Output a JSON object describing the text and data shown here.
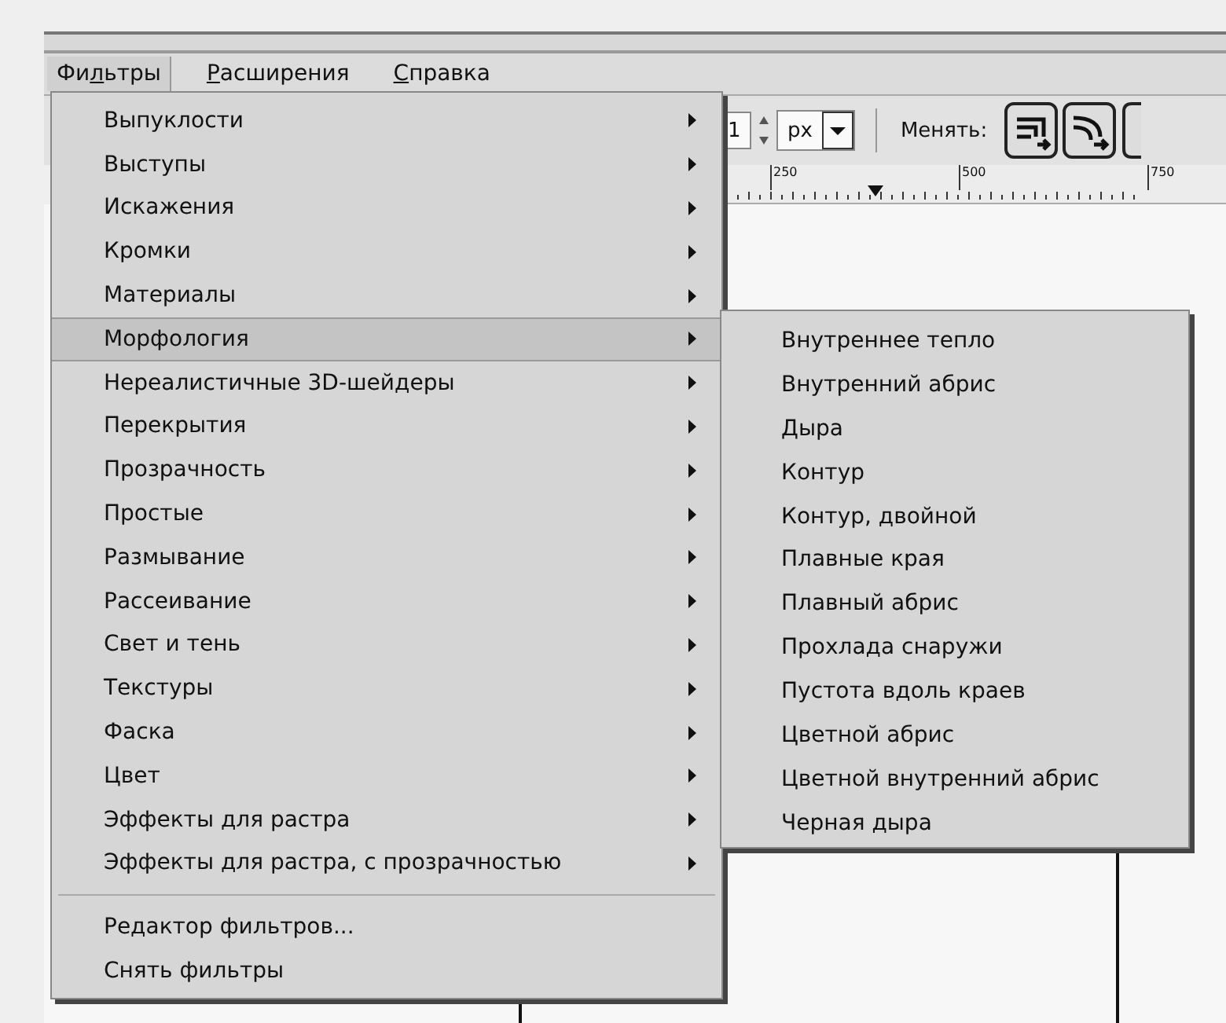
{
  "menubar": [
    {
      "before": "Фи",
      "key": "л",
      "after": "ьтры",
      "selected": true
    },
    {
      "key": "Р",
      "after": "асширения",
      "selected": false
    },
    {
      "key": "С",
      "after": "правка",
      "selected": false
    }
  ],
  "toolbar": {
    "spin_value": "1",
    "unit": "px",
    "label": "Менять:"
  },
  "ruler": {
    "labels": [
      "250",
      "500",
      "750"
    ]
  },
  "menu": [
    {
      "kind": "submenu",
      "label": "Выпуклости",
      "selected": false
    },
    {
      "kind": "submenu",
      "label": "Выступы",
      "selected": false
    },
    {
      "kind": "submenu",
      "label": "Искажения",
      "selected": false
    },
    {
      "kind": "submenu",
      "label": "Кромки",
      "selected": false
    },
    {
      "kind": "submenu",
      "label": "Материалы",
      "selected": false
    },
    {
      "kind": "submenu",
      "label": "Морфология",
      "selected": true
    },
    {
      "kind": "submenu",
      "label": "Нереалистичные 3D-шейдеры",
      "selected": false
    },
    {
      "kind": "submenu",
      "label": "Перекрытия",
      "selected": false
    },
    {
      "kind": "submenu",
      "label": "Прозрачность",
      "selected": false
    },
    {
      "kind": "submenu",
      "label": "Простые",
      "selected": false
    },
    {
      "kind": "submenu",
      "label": "Размывание",
      "selected": false
    },
    {
      "kind": "submenu",
      "label": "Рассеивание",
      "selected": false
    },
    {
      "kind": "submenu",
      "label": "Свет и тень",
      "selected": false
    },
    {
      "kind": "submenu",
      "label": "Текстуры",
      "selected": false
    },
    {
      "kind": "submenu",
      "label": "Фаска",
      "selected": false
    },
    {
      "kind": "submenu",
      "label": "Цвет",
      "selected": false
    },
    {
      "kind": "submenu",
      "label": "Эффекты для растра",
      "selected": false
    },
    {
      "kind": "submenu",
      "label": "Эффекты для растра, с прозрачностью",
      "selected": false
    },
    {
      "kind": "separator"
    },
    {
      "kind": "action",
      "label": "Редактор фильтров...",
      "selected": false
    },
    {
      "kind": "action",
      "label": "Снять фильтры",
      "selected": false
    }
  ],
  "submenu": [
    "Внутреннее тепло",
    "Внутренний абрис",
    "Дыра",
    "Контур",
    "Контур, двойной",
    "Плавные края",
    "Плавный абрис",
    "Прохлада снаружи",
    "Пустота вдоль краев",
    "Цветной абрис",
    "Цветной внутренний абрис",
    "Черная дыра"
  ]
}
